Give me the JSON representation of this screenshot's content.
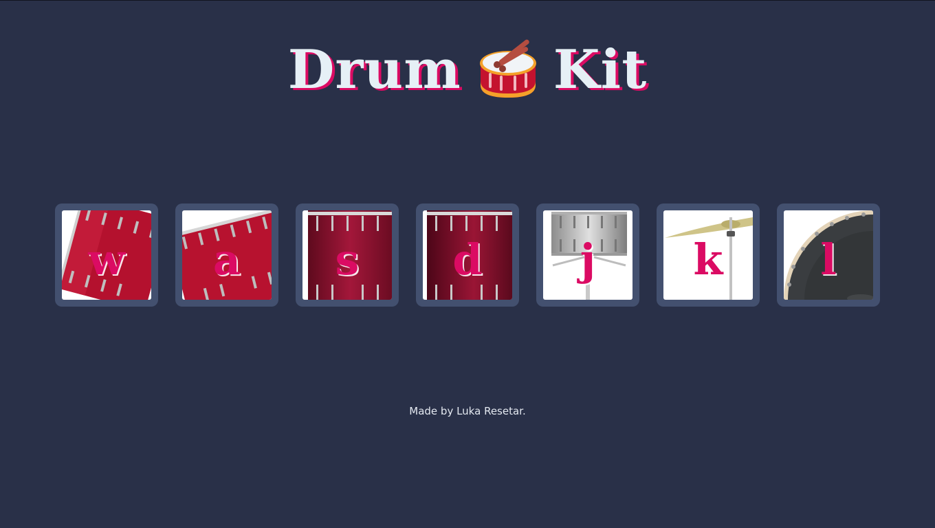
{
  "page": {
    "title_left": "Drum",
    "title_right": "Kit",
    "title_emoji_icon": "drum-icon",
    "footer": "Made by Luka Resetar."
  },
  "colors": {
    "background": "#293048",
    "accent": "#db0b63",
    "title_text": "#e6f0f6",
    "button_frame": "#43506f"
  },
  "drums": [
    {
      "key": "w",
      "instrument_icon": "tom-drum-icon"
    },
    {
      "key": "a",
      "instrument_icon": "tom-drum-icon"
    },
    {
      "key": "s",
      "instrument_icon": "tom-drum-icon"
    },
    {
      "key": "d",
      "instrument_icon": "tom-drum-icon"
    },
    {
      "key": "j",
      "instrument_icon": "snare-drum-icon"
    },
    {
      "key": "k",
      "instrument_icon": "cymbal-icon"
    },
    {
      "key": "l",
      "instrument_icon": "bass-drum-icon"
    }
  ]
}
